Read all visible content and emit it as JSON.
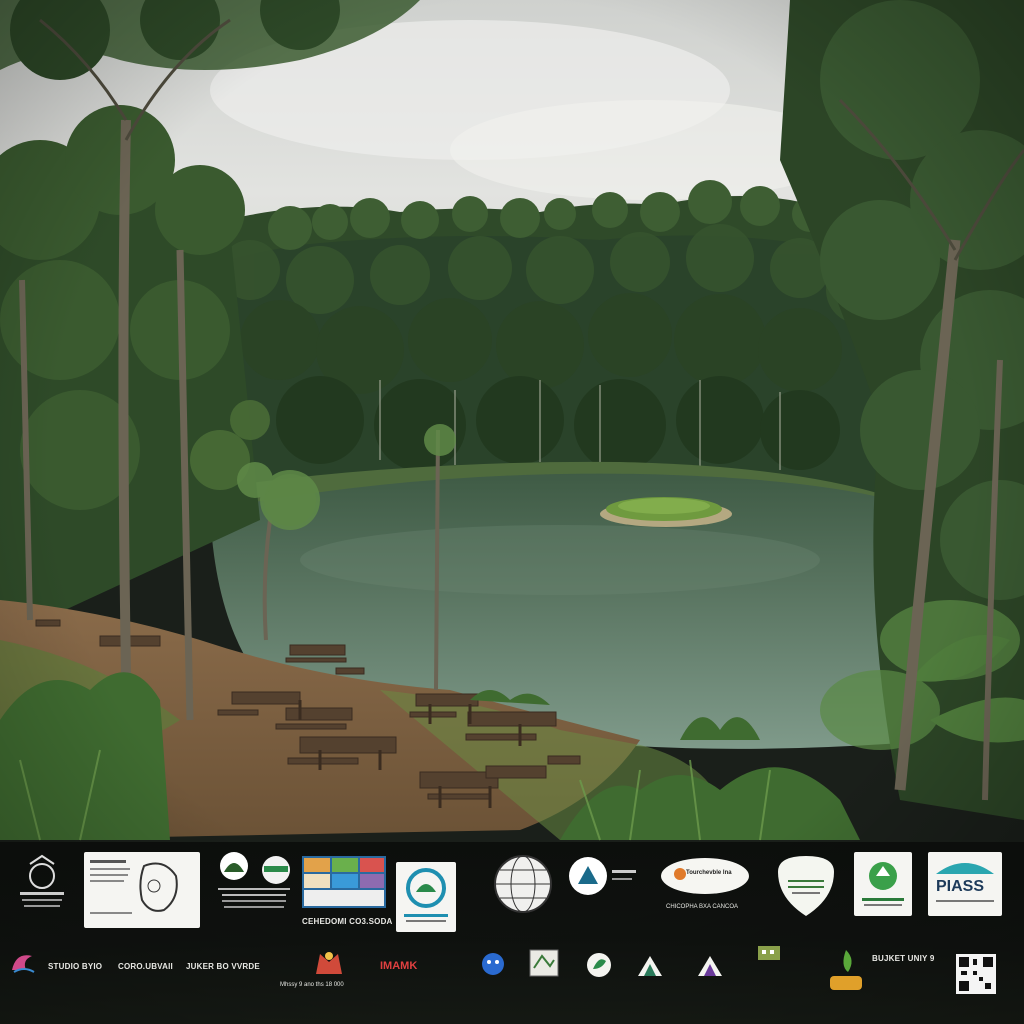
{
  "scene": {
    "description_icons": [
      "forest-icon",
      "lake-icon",
      "island-icon",
      "picnic-table-icon"
    ],
    "colors": {
      "sky": "#d9dbd8",
      "forest_dark": "#233b1f",
      "forest_mid": "#3d5e2f",
      "water": "#5e7a66",
      "island": "#7ea24a",
      "path": "#8b6a4a",
      "table_wood": "#5a4636"
    }
  },
  "logos": {
    "row1": [
      {
        "icon": "badge-icon",
        "text": "",
        "caption": ""
      },
      {
        "icon": "document-icon",
        "text": "",
        "caption": ""
      },
      {
        "icon": "emblem-icon",
        "text": "",
        "caption": ""
      },
      {
        "icon": "photo-collage-icon",
        "text": "",
        "caption": "CEHEDOMI CO3.SODA"
      },
      {
        "icon": "circle-logo-icon",
        "text": "",
        "caption": ""
      },
      {
        "icon": "globe-icon",
        "text": "",
        "caption": ""
      },
      {
        "icon": "triangle-logo-icon",
        "text": "",
        "caption": ""
      },
      {
        "icon": "oval-logo-icon",
        "text": "Tourchevble Ina",
        "caption": "CHICOPHA BXA CANCOA"
      },
      {
        "icon": "shield-logo-icon",
        "text": "",
        "caption": ""
      },
      {
        "icon": "recycle-logo-icon",
        "text": "",
        "caption": ""
      },
      {
        "icon": "teal-logo-icon",
        "text": "PIASS",
        "caption": ""
      }
    ],
    "row2": [
      {
        "icon": "swirl-icon",
        "text": "",
        "caption": ""
      },
      {
        "icon": "text-logo-icon",
        "text": "STUDIO BYIO",
        "caption": ""
      },
      {
        "icon": "text-logo-icon",
        "text": "CORO.UBVAII",
        "caption": ""
      },
      {
        "icon": "text-logo-icon",
        "text": "JUKER BO VVRDE",
        "caption": ""
      },
      {
        "icon": "crest-icon",
        "text": "",
        "caption": "Mhssy 9 ano ths 18 000"
      },
      {
        "icon": "text-logo-icon",
        "text": "IMAMK",
        "caption": ""
      },
      {
        "icon": "blue-mascot-icon",
        "text": "",
        "caption": ""
      },
      {
        "icon": "map-logo-icon",
        "text": "",
        "caption": ""
      },
      {
        "icon": "leaf-logo-icon",
        "text": "",
        "caption": ""
      },
      {
        "icon": "mountain-logo-icon",
        "text": "",
        "caption": ""
      },
      {
        "icon": "mountain-logo-icon",
        "text": "",
        "caption": ""
      },
      {
        "icon": "building-logo-icon",
        "text": "",
        "caption": ""
      },
      {
        "icon": "figure-logo-icon",
        "text": "",
        "caption": ""
      },
      {
        "icon": "text-logo-icon",
        "text": "BUJKET UNIY 9",
        "caption": ""
      },
      {
        "icon": "qr-code-icon",
        "text": "",
        "caption": ""
      }
    ]
  }
}
